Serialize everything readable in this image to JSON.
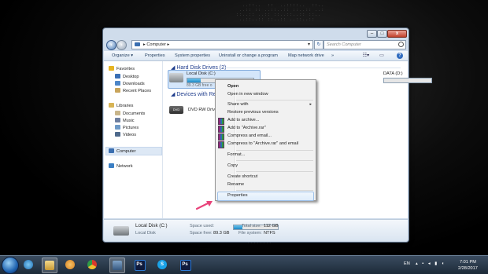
{
  "window": {
    "breadcrumb": "Computer",
    "search_placeholder": "Search Computer"
  },
  "toolbar": {
    "organize": "Organize",
    "properties": "Properties",
    "system_properties": "System properties",
    "uninstall": "Uninstall or change a program",
    "map_drive": "Map network drive",
    "more": "»"
  },
  "sidebar": {
    "favorites": "Favorites",
    "desktop": "Desktop",
    "downloads": "Downloads",
    "recent": "Recent Places",
    "libraries": "Libraries",
    "documents": "Documents",
    "music": "Music",
    "pictures": "Pictures",
    "videos": "Videos",
    "computer": "Computer",
    "network": "Network"
  },
  "content": {
    "hard_disk_group": "Hard Disk Drives (2)",
    "devices_group": "Devices with Remo",
    "drive_c": {
      "name": "Local Disk (C:)",
      "free": "89.3 GB free o",
      "used_fraction": 0.2
    },
    "drive_d": {
      "name": "DATA (D:)",
      "used_fraction": 0.0
    },
    "dvd": {
      "name": "DVD RW Drive",
      "badge": "DVD"
    }
  },
  "context_menu": {
    "open": "Open",
    "open_new_window": "Open in new window",
    "share_with": "Share with",
    "restore": "Restore previous versions",
    "add_archive": "Add to archive...",
    "add_rar": "Add to \"Archive.rar\"",
    "compress_email": "Compress and email...",
    "compress_rar_email": "Compress to \"Archive.rar\" and email",
    "format": "Format...",
    "copy": "Copy",
    "create_shortcut": "Create shortcut",
    "rename": "Rename",
    "properties": "Properties"
  },
  "details": {
    "name": "Local Disk (C:)",
    "type": "Local Disk",
    "space_used_label": "Space used:",
    "space_free_label": "Space free:",
    "space_free": "89.3 GB",
    "total_size_label": "Total size:",
    "total_size": "112 GB",
    "fs_label": "File system:",
    "fs": "NTFS",
    "used_fraction": 0.2
  },
  "taskbar": {
    "lang": "EN",
    "time": "7:01 PM",
    "date": "2/28/2017",
    "ps": "Ps"
  },
  "colors": {
    "accent": "#2f6bbf",
    "drive_bar": "#1b87c5",
    "arrow": "#e8437a"
  }
}
